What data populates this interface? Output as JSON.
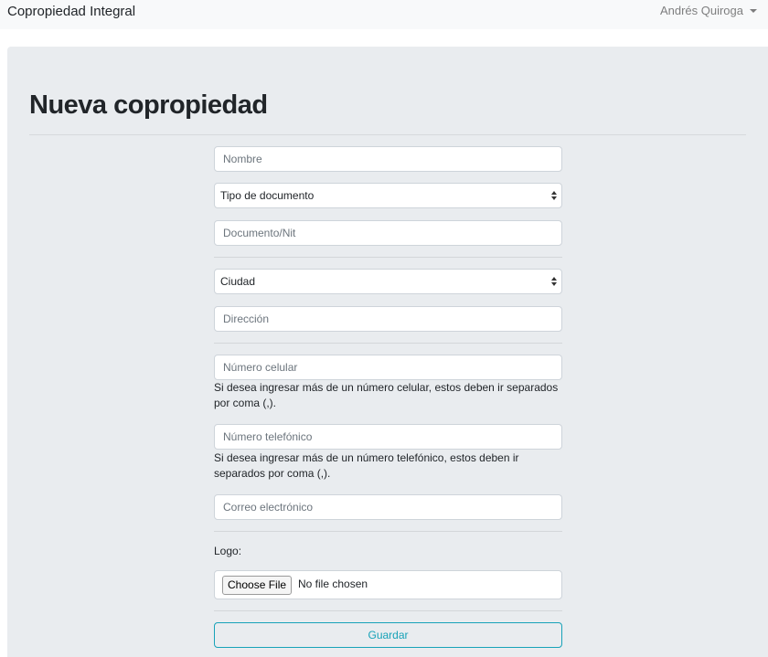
{
  "navbar": {
    "brand": "Copropiedad Integral",
    "user_name": "Andrés Quiroga"
  },
  "page": {
    "title": "Nueva copropiedad"
  },
  "form": {
    "nombre_placeholder": "Nombre",
    "tipo_documento_selected": "Tipo de documento",
    "documento_placeholder": "Documento/Nit",
    "ciudad_selected": "Ciudad",
    "direccion_placeholder": "Dirección",
    "celular_placeholder": "Número celular",
    "celular_help": "Si desea ingresar más de un número celular, estos deben ir separados por coma (,).",
    "telefono_placeholder": "Número telefónico",
    "telefono_help": "Si desea ingresar más de un número telefónico, estos deben ir separados por coma (,).",
    "correo_placeholder": "Correo electrónico",
    "logo_label": "Logo:",
    "file_button": "Choose File",
    "file_status": "No file chosen",
    "submit_label": "Guardar"
  },
  "colors": {
    "navbar_bg": "#f8f9fa",
    "jumbotron_bg": "#e9ecef",
    "accent": "#17a2b8"
  }
}
